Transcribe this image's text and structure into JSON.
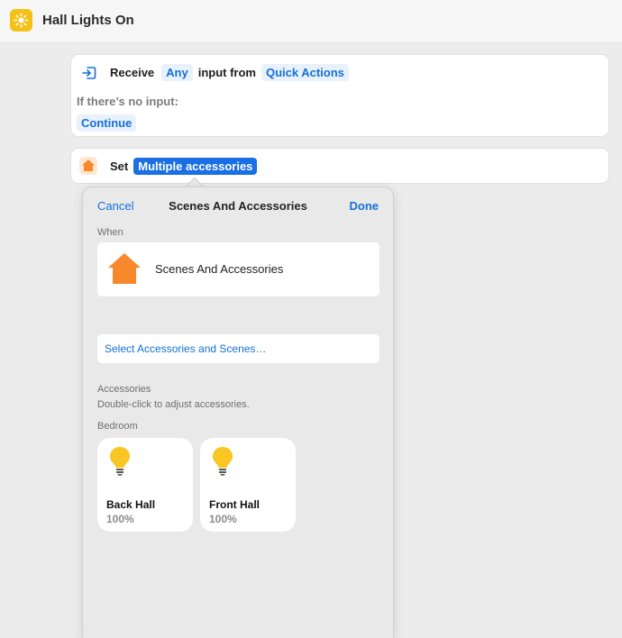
{
  "window": {
    "title": "Hall Lights On",
    "app_icon": "sun-icon"
  },
  "receive_action": {
    "label_receive": "Receive",
    "input_type": "Any",
    "label_input_from": "input from",
    "source": "Quick Actions",
    "no_input_label": "If there’s no input:",
    "no_input_behavior": "Continue"
  },
  "set_action": {
    "icon": "home-icon",
    "label_set": "Set",
    "target": "Multiple accessories"
  },
  "popover": {
    "cancel_label": "Cancel",
    "title": "Scenes And Accessories",
    "done_label": "Done",
    "when_label": "When",
    "when_value": "Scenes And Accessories",
    "select_link": "Select Accessories and Scenes…",
    "accessories_label": "Accessories",
    "accessories_hint": "Double-click to adjust accessories.",
    "room_label": "Bedroom",
    "tiles": [
      {
        "name": "Back Hall",
        "value": "100%",
        "icon": "lightbulb-icon"
      },
      {
        "name": "Front Hall",
        "value": "100%",
        "icon": "lightbulb-icon"
      }
    ]
  },
  "colors": {
    "accent": "#1470d9",
    "selected_token": "#1a6fe5",
    "app_icon_bg": "#f2c21a",
    "home_orange": "#f7892c",
    "bulb_yellow": "#f9c623"
  }
}
